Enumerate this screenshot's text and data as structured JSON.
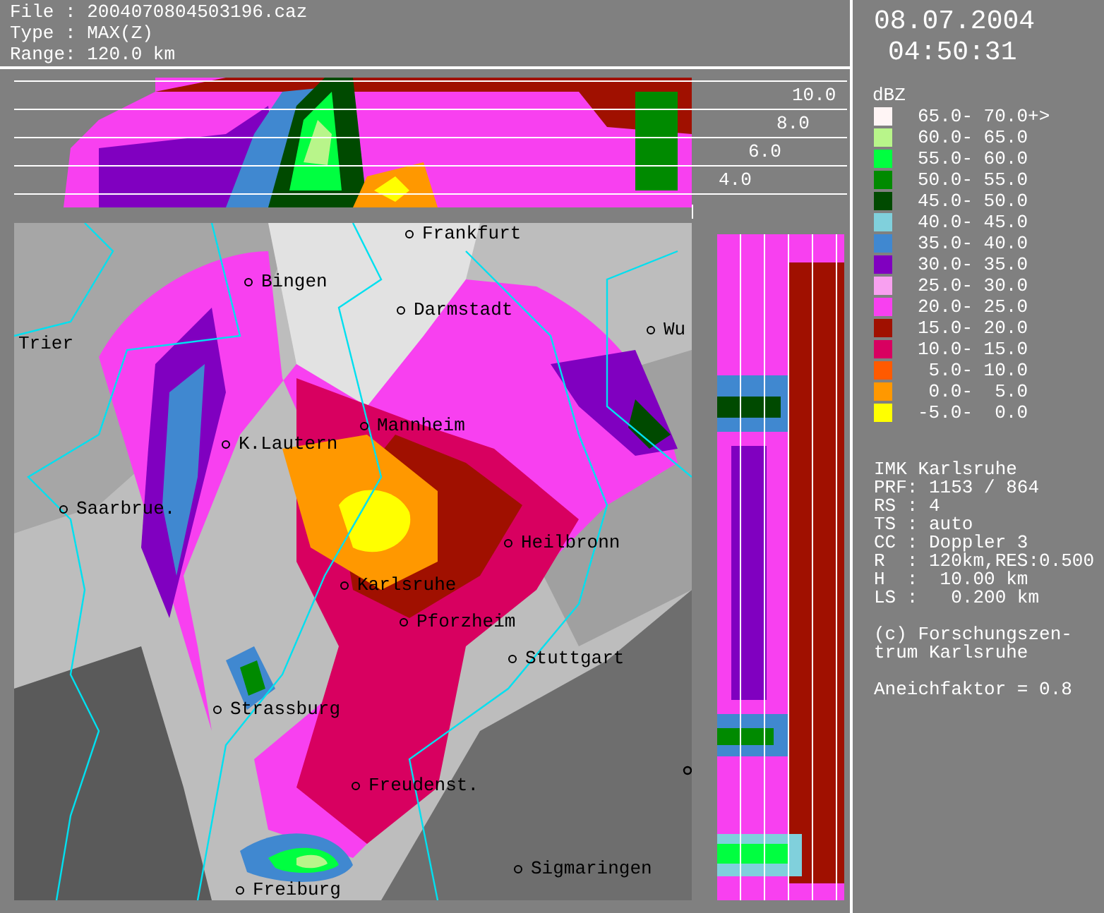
{
  "header": {
    "lines": [
      "File : 2004070804503196.caz",
      "Type : MAX(Z)",
      "Range: 120.0 km"
    ]
  },
  "height_profile": {
    "height_labels": [
      "10.0",
      "8.0",
      "6.0",
      "4.0"
    ]
  },
  "map": {
    "cities": [
      {
        "name": "Frankfurt"
      },
      {
        "name": "Bingen"
      },
      {
        "name": "Darmstadt"
      },
      {
        "name": "Wu"
      },
      {
        "name": "Trier"
      },
      {
        "name": "Mannheim"
      },
      {
        "name": "K.Lautern"
      },
      {
        "name": "Saarbrue."
      },
      {
        "name": "Heilbronn"
      },
      {
        "name": "Karlsruhe"
      },
      {
        "name": "Pforzheim"
      },
      {
        "name": "Stuttgart"
      },
      {
        "name": "Strassburg"
      },
      {
        "name": "Freudenst."
      },
      {
        "name": "Sigmaringen"
      },
      {
        "name": "Freiburg"
      }
    ]
  },
  "side_panel": {
    "date": "08.07.2004",
    "time": "04:50:31",
    "legend": {
      "unit": "dBZ",
      "items": [
        {
          "label": "65.0- 70.0+>",
          "color": "#fff5f5"
        },
        {
          "label": "60.0- 65.0",
          "color": "#b8f58a"
        },
        {
          "label": "55.0- 60.0",
          "color": "#00ff40"
        },
        {
          "label": "50.0- 55.0",
          "color": "#008a00"
        },
        {
          "label": "45.0- 50.0",
          "color": "#004a00"
        },
        {
          "label": "40.0- 45.0",
          "color": "#80d0dc"
        },
        {
          "label": "35.0- 40.0",
          "color": "#4088d0"
        },
        {
          "label": "30.0- 35.0",
          "color": "#8000c0"
        },
        {
          "label": "25.0- 30.0",
          "color": "#f8a0f0"
        },
        {
          "label": "20.0- 25.0",
          "color": "#f840f0"
        },
        {
          "label": "15.0- 20.0",
          "color": "#a01000"
        },
        {
          "label": "10.0- 15.0",
          "color": "#d80060"
        },
        {
          "label": " 5.0- 10.0",
          "color": "#ff5a00"
        },
        {
          "label": " 0.0-  5.0",
          "color": "#ff9800"
        },
        {
          "label": "-5.0-  0.0",
          "color": "#ffff00"
        }
      ]
    },
    "info_lines": [
      "IMK Karlsruhe",
      "PRF: 1153 / 864",
      "RS : 4",
      "TS : auto",
      "CC : Doppler 3",
      "R  : 120km,RES:0.500",
      "H  :  10.00 km",
      "LS :   0.200 km"
    ],
    "copyright_lines": [
      "(c) Forschungszen-",
      "trum Karlsruhe"
    ],
    "factor": "Aneichfaktor = 0.8"
  }
}
